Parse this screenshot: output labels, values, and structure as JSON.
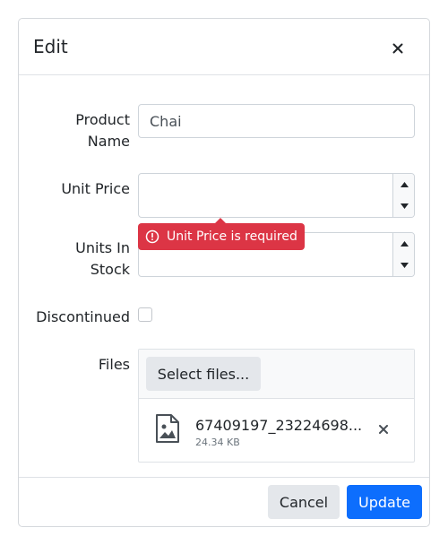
{
  "dialog": {
    "title": "Edit",
    "close_icon": "close-icon"
  },
  "form": {
    "product_name": {
      "label_line1": "Product",
      "label_line2": "Name",
      "value": "Chai"
    },
    "unit_price": {
      "label": "Unit Price",
      "value": ""
    },
    "validation": {
      "message": "Unit Price is required",
      "icon": "error-circle-icon",
      "color": "#dc3545"
    },
    "units_in_stock": {
      "label_line1": "Units In",
      "label_line2": "Stock",
      "value": ""
    },
    "discontinued": {
      "label": "Discontinued",
      "checked": false
    },
    "files": {
      "label": "Files",
      "select_label": "Select files...",
      "items": [
        {
          "name": "67409197_23224698...",
          "size": "24.34 KB",
          "icon": "image-file-icon"
        }
      ]
    }
  },
  "footer": {
    "cancel_label": "Cancel",
    "update_label": "Update",
    "primary_color": "#0d6efd"
  }
}
